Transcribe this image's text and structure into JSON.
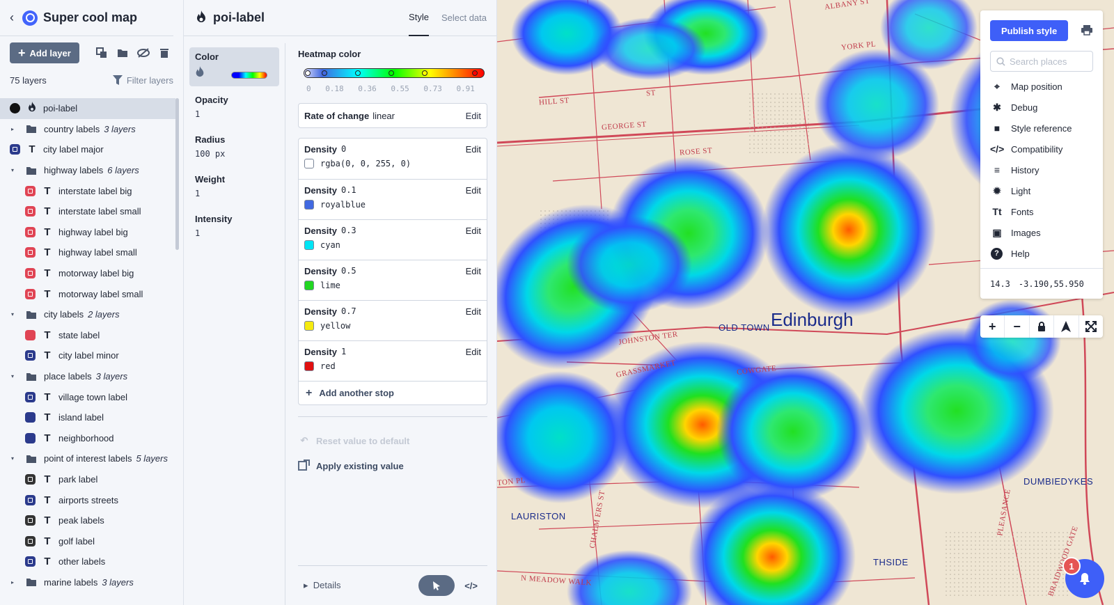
{
  "app": {
    "title": "Super cool map"
  },
  "toolbar": {
    "add_layer": "Add layer"
  },
  "layers_meta": {
    "count": "75 layers",
    "filter_label": "Filter layers"
  },
  "layers": [
    {
      "name": "poi-label",
      "kind": "heatmap",
      "chip": "#111111",
      "selected": true
    },
    {
      "name": "country labels",
      "kind": "group",
      "sub": "3 layers",
      "open": false
    },
    {
      "name": "city label major",
      "kind": "symbol",
      "chip": "#2b3a8c"
    },
    {
      "name": "highway labels",
      "kind": "group",
      "sub": "6 layers",
      "open": true
    },
    {
      "name": "interstate label big",
      "kind": "symbol",
      "chip": "#e04454",
      "child": true
    },
    {
      "name": "interstate label small",
      "kind": "symbol",
      "chip": "#e04454",
      "child": true
    },
    {
      "name": "highway label big",
      "kind": "symbol",
      "chip": "#e04454",
      "child": true
    },
    {
      "name": "highway label small",
      "kind": "symbol",
      "chip": "#e04454",
      "child": true
    },
    {
      "name": "motorway label big",
      "kind": "symbol",
      "chip": "#e04454",
      "child": true
    },
    {
      "name": "motorway label small",
      "kind": "symbol",
      "chip": "#e04454",
      "child": true
    },
    {
      "name": "city labels",
      "kind": "group",
      "sub": "2 layers",
      "open": true
    },
    {
      "name": "state label",
      "kind": "symbol",
      "chip": "#e04454",
      "child": true,
      "plain": true
    },
    {
      "name": "city label minor",
      "kind": "symbol",
      "chip": "#2b3a8c",
      "child": true
    },
    {
      "name": "place labels",
      "kind": "group",
      "sub": "3 layers",
      "open": true
    },
    {
      "name": "village town label",
      "kind": "symbol",
      "chip": "#2b3a8c",
      "child": true
    },
    {
      "name": "island label",
      "kind": "symbol",
      "chip": "#2b3a8c",
      "child": true,
      "plain": true
    },
    {
      "name": "neighborhood",
      "kind": "symbol",
      "chip": "#2b3a8c",
      "child": true,
      "plain": true
    },
    {
      "name": "point of interest labels",
      "kind": "group",
      "sub": "5 layers",
      "open": true
    },
    {
      "name": "park label",
      "kind": "symbol",
      "chip": "#333333",
      "child": true
    },
    {
      "name": "airports streets",
      "kind": "symbol",
      "chip": "#2b3a8c",
      "child": true
    },
    {
      "name": "peak labels",
      "kind": "symbol",
      "chip": "#333333",
      "child": true
    },
    {
      "name": "golf label",
      "kind": "symbol",
      "chip": "#333333",
      "child": true
    },
    {
      "name": "other labels",
      "kind": "symbol",
      "chip": "#2b3a8c",
      "child": true
    },
    {
      "name": "marine labels",
      "kind": "group",
      "sub": "3 layers",
      "open": false
    }
  ],
  "props": {
    "layer_name": "poi-label",
    "tab_style": "Style",
    "tab_select": "Select data",
    "nav": [
      {
        "label": "Color",
        "value": ""
      },
      {
        "label": "Opacity",
        "value": "1"
      },
      {
        "label": "Radius",
        "value": "100 px"
      },
      {
        "label": "Weight",
        "value": "1"
      },
      {
        "label": "Intensity",
        "value": "1"
      }
    ],
    "heatmap_title": "Heatmap color",
    "ticks": [
      "0",
      "0.18",
      "0.36",
      "0.55",
      "0.73",
      "0.91"
    ],
    "rate_label": "Rate of change",
    "rate_value": "linear",
    "edit_label": "Edit",
    "density_label": "Density",
    "stops": [
      {
        "density": "0",
        "color_text": "rgba(0, 0, 255, 0)",
        "swatch": "#ffffff"
      },
      {
        "density": "0.1",
        "color_text": "royalblue",
        "swatch": "#4169e1"
      },
      {
        "density": "0.3",
        "color_text": "cyan",
        "swatch": "#00e5f5"
      },
      {
        "density": "0.5",
        "color_text": "lime",
        "swatch": "#22d622"
      },
      {
        "density": "0.7",
        "color_text": "yellow",
        "swatch": "#f5ea10"
      },
      {
        "density": "1",
        "color_text": "red",
        "swatch": "#e01010"
      }
    ],
    "add_stop": "Add another stop",
    "reset": "Reset value to default",
    "apply": "Apply existing value",
    "details": "Details"
  },
  "map_labels": {
    "albany": "ALBANY ST",
    "york": "YORK PL",
    "george": "GEORGE ST",
    "rose": "ROSE ST",
    "st": "ST",
    "hill": "HILL ST",
    "old_town": "OLD TOWN",
    "edinburgh": "Edinburgh",
    "johnston": "JOHNSTON TER",
    "cowgate": "COWGATE",
    "grassmarket": "GRASSMARKET",
    "lauriston": "LAURISTON",
    "chalm": "CHALM ERS ST",
    "meadow": "N MEADOW WALK",
    "dumbiedykes": "DUMBIEDYKES",
    "thside": "THSIDE",
    "pleasance": "PLEASANCE",
    "braidwood": "BRAIDWOOD GATE",
    "ton": "TON PL"
  },
  "side": {
    "publish": "Publish style",
    "search_placeholder": "Search places",
    "menu": [
      {
        "label": "Map position",
        "icon": "crosshair-icon"
      },
      {
        "label": "Debug",
        "icon": "bug-icon"
      },
      {
        "label": "Style reference",
        "icon": "book-icon"
      },
      {
        "label": "Compatibility",
        "icon": "code-icon"
      },
      {
        "label": "History",
        "icon": "history-icon"
      },
      {
        "label": "Light",
        "icon": "light-icon"
      },
      {
        "label": "Fonts",
        "icon": "fonts-icon"
      },
      {
        "label": "Images",
        "icon": "images-icon"
      },
      {
        "label": "Help",
        "icon": "help-icon"
      }
    ],
    "zoom": "14.3",
    "coords": "-3.190,55.950"
  },
  "notifications": {
    "count": "1"
  }
}
